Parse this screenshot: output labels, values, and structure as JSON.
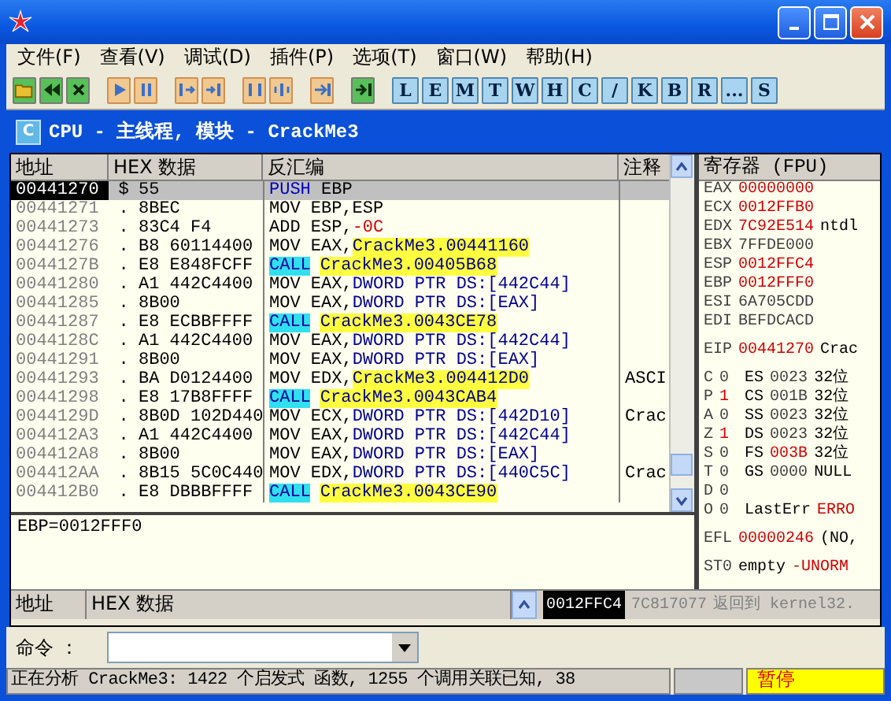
{
  "menu": [
    "文件(F)",
    "查看(V)",
    "调试(D)",
    "插件(P)",
    "选项(T)",
    "窗口(W)",
    "帮助(H)"
  ],
  "letter_buttons": [
    "L",
    "E",
    "M",
    "T",
    "W",
    "H",
    "C",
    "/",
    "K",
    "B",
    "R",
    "...",
    "S"
  ],
  "cpu_window": {
    "title": "CPU - 主线程, 模块 - CrackMe3",
    "icon_letter": "C"
  },
  "disasm": {
    "columns": [
      "地址",
      "HEX 数据",
      "反汇编",
      "注释"
    ],
    "rows": [
      {
        "address": "00441270",
        "mark": "$",
        "hex": "55",
        "selected": true,
        "instr": [
          {
            "kind": "push",
            "text": "PUSH"
          },
          {
            "kind": "plain",
            "text": " EBP"
          }
        ]
      },
      {
        "address": "00441271",
        "mark": ".",
        "hex": "8BEC",
        "selected": false,
        "instr": [
          {
            "kind": "plain",
            "text": "MOV EBP,ESP"
          }
        ]
      },
      {
        "address": "00441273",
        "mark": ".",
        "hex": "83C4 F4",
        "selected": false,
        "instr": [
          {
            "kind": "plain",
            "text": "ADD ESP,"
          },
          {
            "kind": "const",
            "text": "-0C"
          }
        ]
      },
      {
        "address": "00441276",
        "mark": ".",
        "hex": "B8 60114400",
        "selected": false,
        "instr": [
          {
            "kind": "plain",
            "text": "MOV EAX,"
          },
          {
            "kind": "label",
            "text": "CrackMe3.00441160"
          }
        ]
      },
      {
        "address": "0044127B",
        "mark": ".",
        "hex": "E8 E848FCFF",
        "selected": false,
        "instr": [
          {
            "kind": "call",
            "text": "CALL"
          },
          {
            "kind": "label",
            "text": "CrackMe3.00405B68"
          }
        ]
      },
      {
        "address": "00441280",
        "mark": ".",
        "hex": "A1 442C4400",
        "selected": false,
        "instr": [
          {
            "kind": "plain",
            "text": "MOV EAX,"
          },
          {
            "kind": "mem",
            "text": "DWORD PTR DS:[442C44]"
          }
        ]
      },
      {
        "address": "00441285",
        "mark": ".",
        "hex": "8B00",
        "selected": false,
        "instr": [
          {
            "kind": "plain",
            "text": "MOV EAX,"
          },
          {
            "kind": "mem",
            "text": "DWORD PTR DS:[EAX]"
          }
        ]
      },
      {
        "address": "00441287",
        "mark": ".",
        "hex": "E8 ECBBFFFF",
        "selected": false,
        "instr": [
          {
            "kind": "call",
            "text": "CALL"
          },
          {
            "kind": "label",
            "text": "CrackMe3.0043CE78"
          }
        ]
      },
      {
        "address": "0044128C",
        "mark": ".",
        "hex": "A1 442C4400",
        "selected": false,
        "instr": [
          {
            "kind": "plain",
            "text": "MOV EAX,"
          },
          {
            "kind": "mem",
            "text": "DWORD PTR DS:[442C44]"
          }
        ]
      },
      {
        "address": "00441291",
        "mark": ".",
        "hex": "8B00",
        "selected": false,
        "instr": [
          {
            "kind": "plain",
            "text": "MOV EAX,"
          },
          {
            "kind": "mem",
            "text": "DWORD PTR DS:[EAX]"
          }
        ]
      },
      {
        "address": "00441293",
        "mark": ".",
        "hex": "BA D0124400",
        "selected": false,
        "instr": [
          {
            "kind": "plain",
            "text": "MOV EDX,"
          },
          {
            "kind": "label",
            "text": "CrackMe3.004412D0"
          }
        ],
        "comment": "ASCI"
      },
      {
        "address": "00441298",
        "mark": ".",
        "hex": "E8 17B8FFFF",
        "selected": false,
        "instr": [
          {
            "kind": "call",
            "text": "CALL"
          },
          {
            "kind": "label",
            "text": "CrackMe3.0043CAB4"
          }
        ]
      },
      {
        "address": "0044129D",
        "mark": ".",
        "hex": "8B0D 102D440",
        "selected": false,
        "instr": [
          {
            "kind": "plain",
            "text": "MOV ECX,"
          },
          {
            "kind": "mem",
            "text": "DWORD PTR DS:[442D10]"
          }
        ],
        "comment": "Crac"
      },
      {
        "address": "004412A3",
        "mark": ".",
        "hex": "A1 442C4400",
        "selected": false,
        "instr": [
          {
            "kind": "plain",
            "text": "MOV EAX,"
          },
          {
            "kind": "mem",
            "text": "DWORD PTR DS:[442C44]"
          }
        ]
      },
      {
        "address": "004412A8",
        "mark": ".",
        "hex": "8B00",
        "selected": false,
        "instr": [
          {
            "kind": "plain",
            "text": "MOV EAX,"
          },
          {
            "kind": "mem",
            "text": "DWORD PTR DS:[EAX]"
          }
        ]
      },
      {
        "address": "004412AA",
        "mark": ".",
        "hex": "8B15 5C0C440",
        "selected": false,
        "instr": [
          {
            "kind": "plain",
            "text": "MOV EDX,"
          },
          {
            "kind": "mem",
            "text": "DWORD PTR DS:[440C5C]"
          }
        ],
        "comment": "Crac"
      },
      {
        "address": "004412B0",
        "mark": ".",
        "hex": "E8 DBBBFFFF",
        "selected": false,
        "instr": [
          {
            "kind": "call",
            "text": "CALL"
          },
          {
            "kind": "label",
            "text": "CrackMe3.0043CE90"
          }
        ]
      }
    ]
  },
  "info": "EBP=0012FFF0",
  "registers": {
    "title": "寄存器 (FPU)",
    "general": [
      {
        "name": "EAX",
        "value": "00000000",
        "changed": true
      },
      {
        "name": "ECX",
        "value": "0012FFB0",
        "changed": true
      },
      {
        "name": "EDX",
        "value": "7C92E514",
        "changed": true,
        "comment": "ntdl"
      },
      {
        "name": "EBX",
        "value": "7FFDE000",
        "changed": false
      },
      {
        "name": "ESP",
        "value": "0012FFC4",
        "changed": true
      },
      {
        "name": "EBP",
        "value": "0012FFF0",
        "changed": true
      },
      {
        "name": "ESI",
        "value": "6A705CDD",
        "changed": false
      },
      {
        "name": "EDI",
        "value": "BEFDCACD",
        "changed": false
      }
    ],
    "eip": {
      "name": "EIP",
      "value": "00441270",
      "changed": true,
      "comment": "Crac"
    },
    "flags": [
      {
        "flag": "C",
        "bit": "0",
        "changed": false,
        "segment": {
          "name": "ES",
          "selector": "0023",
          "changed": false,
          "info": "32位"
        }
      },
      {
        "flag": "P",
        "bit": "1",
        "changed": true,
        "segment": {
          "name": "CS",
          "selector": "001B",
          "changed": false,
          "info": "32位"
        }
      },
      {
        "flag": "A",
        "bit": "0",
        "changed": false,
        "segment": {
          "name": "SS",
          "selector": "0023",
          "changed": false,
          "info": "32位"
        }
      },
      {
        "flag": "Z",
        "bit": "1",
        "changed": true,
        "segment": {
          "name": "DS",
          "selector": "0023",
          "changed": false,
          "info": "32位"
        }
      },
      {
        "flag": "S",
        "bit": "0",
        "changed": false,
        "segment": {
          "name": "FS",
          "selector": "003B",
          "changed": true,
          "info": "32位"
        }
      },
      {
        "flag": "T",
        "bit": "0",
        "changed": false,
        "segment": {
          "name": "GS",
          "selector": "0000",
          "changed": false,
          "info": "NULL"
        }
      },
      {
        "flag": "D",
        "bit": "0",
        "changed": false
      },
      {
        "flag": "O",
        "bit": "0",
        "changed": false,
        "last_error": {
          "label": "LastErr",
          "value": "ERRO"
        }
      }
    ],
    "efl": {
      "name": "EFL",
      "value": "00000246",
      "changed": true,
      "comment": "(NO,"
    },
    "fpu": [
      {
        "name": "ST0",
        "tag": "empty",
        "value": "-UNORM"
      }
    ]
  },
  "dump": {
    "columns": [
      "地址",
      "HEX 数据"
    ]
  },
  "stack": {
    "address": "0012FFC4",
    "value": "7C817077",
    "comment": "返回到 kernel32."
  },
  "command": {
    "label": "命令 ："
  },
  "status": {
    "message": "正在分析 CrackMe3: 1422 个启发式 函数, 1255 个调用关联已知, 38",
    "state": "暂停"
  }
}
